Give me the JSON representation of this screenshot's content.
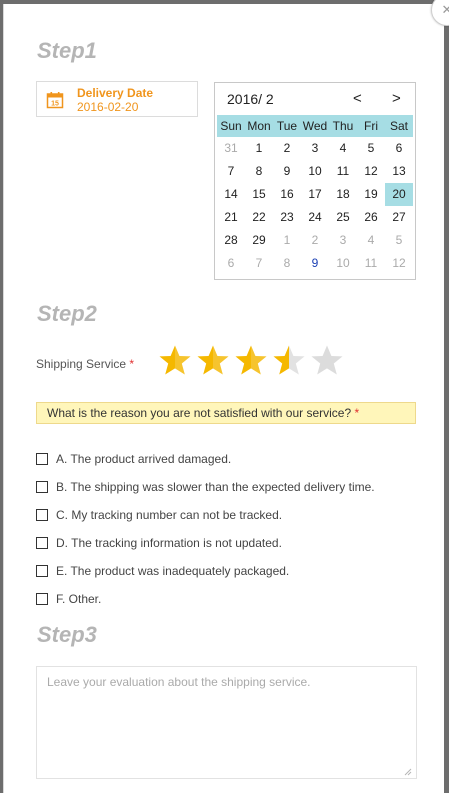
{
  "steps": {
    "step1": "Step1",
    "step2": "Step2",
    "step3": "Step3"
  },
  "delivery": {
    "label": "Delivery Date",
    "value": "2016-02-20"
  },
  "calendar": {
    "title": "2016/ 2",
    "prev": "<",
    "next": ">",
    "weekdays": [
      "Sun",
      "Mon",
      "Tue",
      "Wed",
      "Thu",
      "Fri",
      "Sat"
    ],
    "days": [
      "31",
      "1",
      "2",
      "3",
      "4",
      "5",
      "6",
      "7",
      "8",
      "9",
      "10",
      "11",
      "12",
      "13",
      "14",
      "15",
      "16",
      "17",
      "18",
      "19",
      "20",
      "21",
      "22",
      "23",
      "24",
      "25",
      "26",
      "27",
      "28",
      "29",
      "1",
      "2",
      "3",
      "4",
      "5",
      "6",
      "7",
      "8",
      "9",
      "10",
      "11",
      "12"
    ],
    "selected": "20",
    "today_marker": "9"
  },
  "shipping": {
    "label": "Shipping Service",
    "required": "*",
    "rating": 3.5,
    "max": 5,
    "star_color": "#f5b800",
    "empty_color": "#dcdcdc"
  },
  "question": {
    "text": "What is the reason you are not satisfied with our service?",
    "required": "*"
  },
  "options": [
    "A. The product arrived damaged.",
    "B. The shipping was slower than the expected delivery time.",
    "C. My tracking number can not be tracked.",
    "D. The tracking information is not updated.",
    "E. The product was inadequately packaged.",
    "F. Other."
  ],
  "feedback": {
    "placeholder": "Leave your evaluation about the shipping service."
  },
  "colors": {
    "accent": "#f0951d",
    "highlight": "#a6dde4",
    "question_bg": "#fff6ba"
  }
}
